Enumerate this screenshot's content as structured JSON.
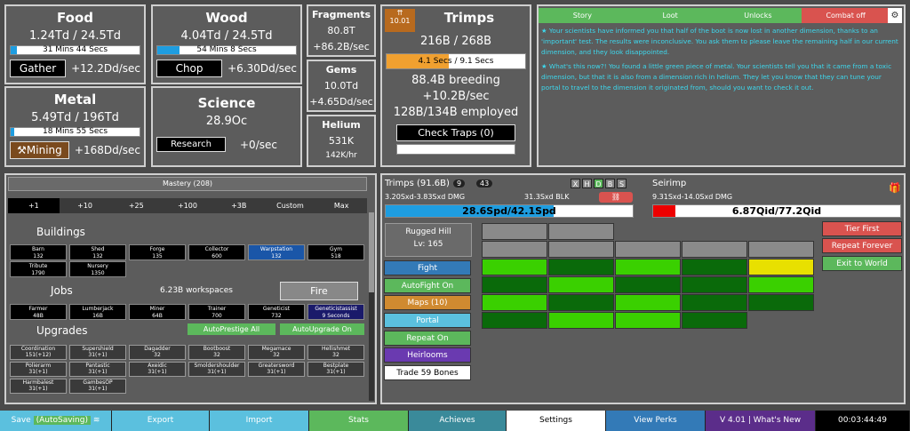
{
  "food": {
    "title": "Food",
    "amount": "1.24Td / 24.5Td",
    "bar_text": "31 Mins 44 Secs",
    "fill": 0.05,
    "button": "Gather",
    "rate": "+12.2Dd/sec"
  },
  "wood": {
    "title": "Wood",
    "amount": "4.04Td / 24.5Td",
    "bar_text": "54 Mins 8 Secs",
    "fill": 0.16,
    "button": "Chop",
    "rate": "+6.30Dd/sec"
  },
  "metal": {
    "title": "Metal",
    "amount": "5.49Td / 196Td",
    "bar_text": "18 Mins 55 Secs",
    "fill": 0.03,
    "button": "Mining",
    "rate": "+168Dd/sec"
  },
  "science": {
    "title": "Science",
    "amount": "28.9Oc",
    "button": "Research",
    "rate": "+0/sec"
  },
  "fragments": {
    "title": "Fragments",
    "amount": "80.8T",
    "rate": "+86.2B/sec"
  },
  "gems": {
    "title": "Gems",
    "amount": "10.0Td",
    "rate": "+4.65Dd/sec"
  },
  "helium": {
    "title": "Helium",
    "amount": "531K",
    "rate": "142K/hr"
  },
  "trimps": {
    "title": "Trimps",
    "time": "10.01",
    "count": "216B / 268B",
    "bar_text": "4.1 Secs / 9.1 Secs",
    "fill": 0.45,
    "breeding": "88.4B breeding",
    "rate": "+10.2B/sec",
    "employed": "128B/134B employed",
    "check_traps": "Check Traps (0)"
  },
  "log": {
    "tabs": [
      "Story",
      "Loot",
      "Unlocks",
      "Combat off"
    ],
    "gear": "⚙",
    "messages": [
      "Your scientists have informed you that half of the boot is now lost in another dimension, thanks to an 'important' test. The results were inconclusive. You ask them to please leave the remaining half in our current dimension, and they look disappointed.",
      "What's this now?! You found a little green piece of metal. Your scientists tell you that it came from a toxic dimension, but that it is also from a dimension rich in helium. They let you know that they can tune your portal to travel to the dimension it originated from, should you want to check it out."
    ]
  },
  "mastery": {
    "title": "Mastery (208)",
    "amounts": [
      "+1",
      "+10",
      "+25",
      "+100",
      "+3B",
      "Custom",
      "Max"
    ],
    "buildings_label": "Buildings",
    "jobs_label": "Jobs",
    "upgrades_label": "Upgrades",
    "workspaces": "6.23B workspaces",
    "fire": "Fire",
    "autoprestige": "AutoPrestige All",
    "autoupgrade": "AutoUpgrade On",
    "buildings": [
      [
        "Barn",
        "132"
      ],
      [
        "Shed",
        "132"
      ],
      [
        "Forge",
        "135"
      ],
      [
        "Collector",
        "600"
      ],
      [
        "Warpstation",
        "132"
      ],
      [
        "Gym",
        "518"
      ],
      [
        "Tribute",
        "1790"
      ],
      [
        "Nursery",
        "1350"
      ]
    ],
    "jobs": [
      [
        "Farmer",
        "48B"
      ],
      [
        "Lumberjack",
        "16B"
      ],
      [
        "Miner",
        "64B"
      ],
      [
        "Trainer",
        "700"
      ],
      [
        "Geneticist",
        "732"
      ],
      [
        "Geneticistassist",
        "9 Seconds"
      ]
    ],
    "upgrades": [
      [
        "Coordination",
        "151(+12)"
      ],
      [
        "Supershield",
        "31(+1)"
      ],
      [
        "Dagadder",
        "32"
      ],
      [
        "Bootboost",
        "32"
      ],
      [
        "Megamace",
        "32"
      ],
      [
        "Hellishmet",
        "32"
      ],
      [
        "Polierarm",
        "31(+1)"
      ],
      [
        "Pantastic",
        "31(+1)"
      ],
      [
        "Axeidic",
        "31(+1)"
      ],
      [
        "Smoldershoulder",
        "31(+1)"
      ],
      [
        "Greatersword",
        "31(+1)"
      ],
      [
        "Bestplate",
        "31(+1)"
      ],
      [
        "Harmbalest",
        "31(+1)"
      ],
      [
        "GambesOP",
        "31(+1)"
      ]
    ]
  },
  "battle": {
    "trimps_label": "Trimps (91.6B)",
    "badge1": "9",
    "badge2": "43",
    "trimp_dmg": "3.20Sxd-3.83Sxd DMG",
    "trimp_blk": "31.3Sxd BLK",
    "trimp_hp": "28.6Spd/42.1Spd",
    "letters": [
      "X",
      "H",
      "D",
      "B",
      "S"
    ],
    "enemy_name": "Seirimp",
    "enemy_dmg": "9.31Sxd-14.0Sxd DMG",
    "enemy_hp": "6.87Qid/77.2Qid",
    "enemy_fill": 0.09,
    "trimp_fill": 0.68,
    "zone": "Rugged Hill",
    "level": "Lv: 165"
  },
  "side_buttons": [
    "Fight",
    "AutoFight On",
    "Maps (10)",
    "Portal",
    "Repeat On",
    "Heirlooms",
    "Trade 59 Bones"
  ],
  "right_buttons": [
    "Tier First",
    "Repeat Forever",
    "Exit to World"
  ],
  "bottom": {
    "save": "Save",
    "autosave": "(AutoSaving)",
    "export": "Export",
    "import": "Import",
    "stats": "Stats",
    "achieves": "Achieves",
    "settings": "Settings",
    "perks": "View Perks",
    "version": "V 4.01 | What's New",
    "time": "00:03:44:49"
  },
  "colors": {
    "blue": "#1e9de0",
    "green": "#5cb85c",
    "red": "#d9534f",
    "teal": "#3bb3c6",
    "purple": "#5b2d8a"
  }
}
